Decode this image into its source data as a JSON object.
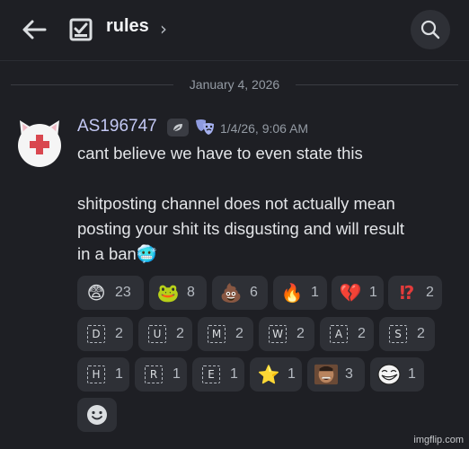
{
  "header": {
    "channel_name": "rules",
    "chevron": "›",
    "back_icon": "arrow-left-icon",
    "channel_icon": "rules-checkbox-icon",
    "search_icon": "search-icon"
  },
  "date_divider": "January 4, 2026",
  "message": {
    "author": "AS196747",
    "author_color": "#c4c9f5",
    "badges": [
      "leaf-badge-icon",
      "theater-masks-icon"
    ],
    "timestamp": "1/4/26, 9:06 AM",
    "lines": [
      "cant believe we have to even state this",
      "",
      "shitposting channel does not actually mean",
      "posting your shit its disgusting and will result",
      "in a ban"
    ],
    "inline_emoji": "🥶"
  },
  "reactions": [
    {
      "emoji": "😨",
      "count": "23"
    },
    {
      "emoji": "🐸",
      "count": "8"
    },
    {
      "emoji": "💩",
      "count": "6"
    },
    {
      "emoji": "🔥",
      "count": "1"
    },
    {
      "emoji": "💔",
      "count": "1"
    },
    {
      "emoji": "⁉",
      "count": "2"
    },
    {
      "letter": "D",
      "count": "2"
    },
    {
      "letter": "U",
      "count": "2"
    },
    {
      "letter": "M",
      "count": "2"
    },
    {
      "letter": "W",
      "count": "2"
    },
    {
      "letter": "A",
      "count": "2"
    },
    {
      "letter": "S",
      "count": "2"
    },
    {
      "letter": "H",
      "count": "1"
    },
    {
      "letter": "R",
      "count": "1"
    },
    {
      "letter": "E",
      "count": "1"
    },
    {
      "emoji": "⭐",
      "count": "1"
    },
    {
      "emoji": "custom-laughing-face",
      "count": "3"
    },
    {
      "emoji": "custom-trollface",
      "count": "1"
    }
  ],
  "add_reaction_icon": "smiley-add-reaction-icon",
  "watermark": "imgflip.com"
}
